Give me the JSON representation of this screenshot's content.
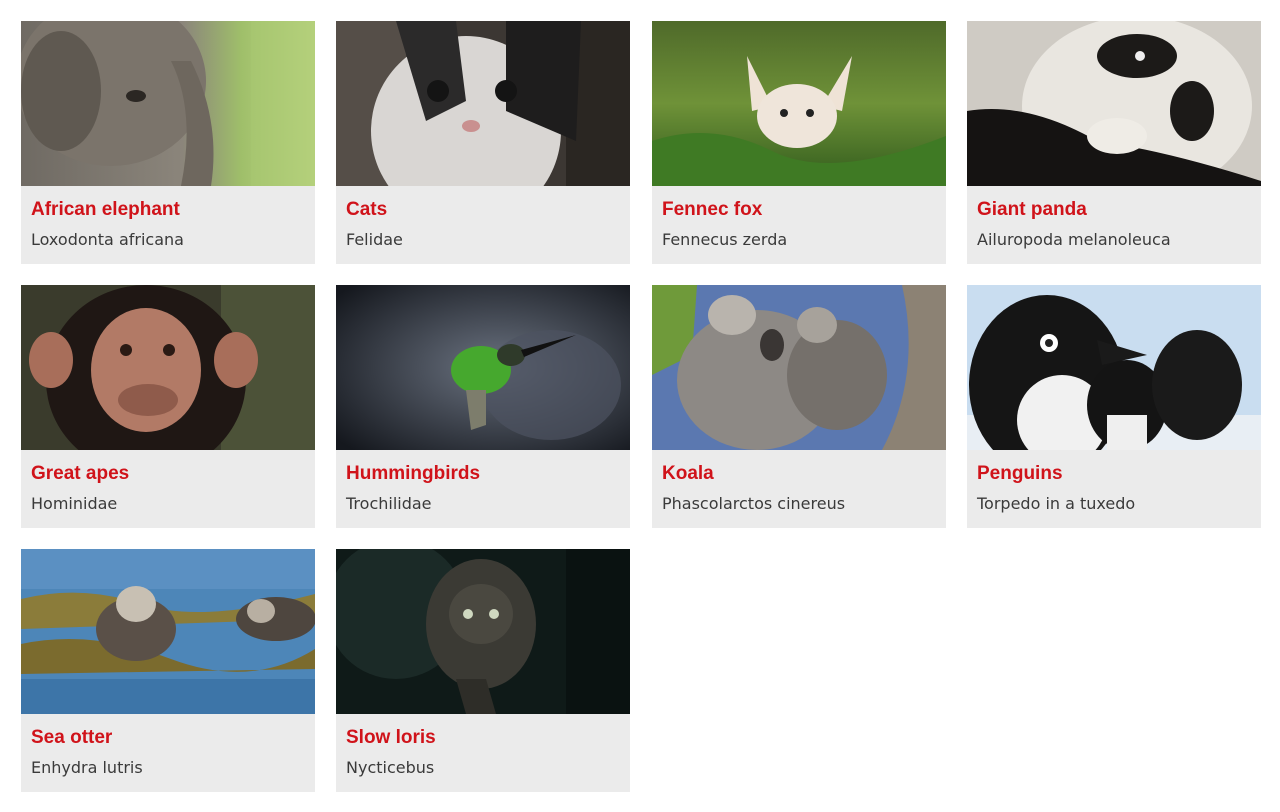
{
  "animals": [
    {
      "title": "African elephant",
      "subtitle": "Loxodonta africana",
      "image": "african-elephant-photo"
    },
    {
      "title": "Cats",
      "subtitle": "Felidae",
      "image": "kitten-photo"
    },
    {
      "title": "Fennec fox",
      "subtitle": "Fennecus zerda",
      "image": "fennec-fox-photo"
    },
    {
      "title": "Giant panda",
      "subtitle": "Ailuropoda melanoleuca",
      "image": "giant-panda-photo"
    },
    {
      "title": "Great apes",
      "subtitle": "Hominidae",
      "image": "chimpanzee-photo"
    },
    {
      "title": "Hummingbirds",
      "subtitle": "Trochilidae",
      "image": "hummingbird-photo"
    },
    {
      "title": "Koala",
      "subtitle": "Phascolarctos cinereus",
      "image": "koala-photo"
    },
    {
      "title": "Penguins",
      "subtitle": "Torpedo in a tuxedo",
      "image": "penguins-photo"
    },
    {
      "title": "Sea otter",
      "subtitle": "Enhydra lutris",
      "image": "sea-otter-photo"
    },
    {
      "title": "Slow loris",
      "subtitle": "Nycticebus",
      "image": "slow-loris-photo"
    }
  ],
  "colors": {
    "title": "#d0131a",
    "subtitle": "#3a3a3a",
    "card_background": "#ebebeb"
  }
}
